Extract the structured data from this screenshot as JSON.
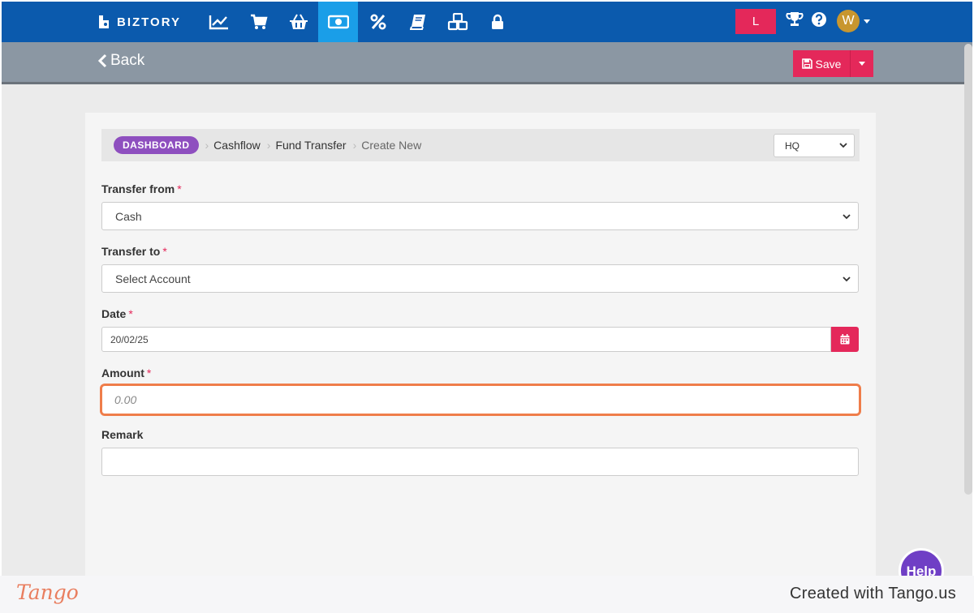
{
  "nav": {
    "brand": "BIZTORY",
    "icons": [
      "chart-line-icon",
      "cart-icon",
      "basket-icon",
      "money-icon",
      "percent-icon",
      "book-icon",
      "cubes-icon",
      "lock-icon"
    ],
    "active_index": 3,
    "user_initial": "L",
    "avatar_initial": "W",
    "accent": "#0b5aad",
    "active_color": "#1a9ee8"
  },
  "subbar": {
    "back_label": "Back",
    "save_label": "Save"
  },
  "breadcrumb": {
    "dashboard": "DASHBOARD",
    "items": [
      "Cashflow",
      "Fund Transfer",
      "Create New"
    ]
  },
  "branch_select": {
    "value": "HQ"
  },
  "form": {
    "transfer_from": {
      "label": "Transfer from",
      "value": "Cash"
    },
    "transfer_to": {
      "label": "Transfer to",
      "placeholder": "Select Account"
    },
    "date": {
      "label": "Date",
      "value": "20/02/25"
    },
    "amount": {
      "label": "Amount",
      "placeholder": "0.00"
    },
    "remark": {
      "label": "Remark",
      "value": ""
    },
    "required_mark": "*"
  },
  "help_label": "Help",
  "footer": {
    "logo": "Tango",
    "created": "Created with Tango.us"
  },
  "colors": {
    "primary_button": "#e4285a",
    "highlight_border": "#ef7d4a",
    "pill": "#8e4fbf"
  }
}
